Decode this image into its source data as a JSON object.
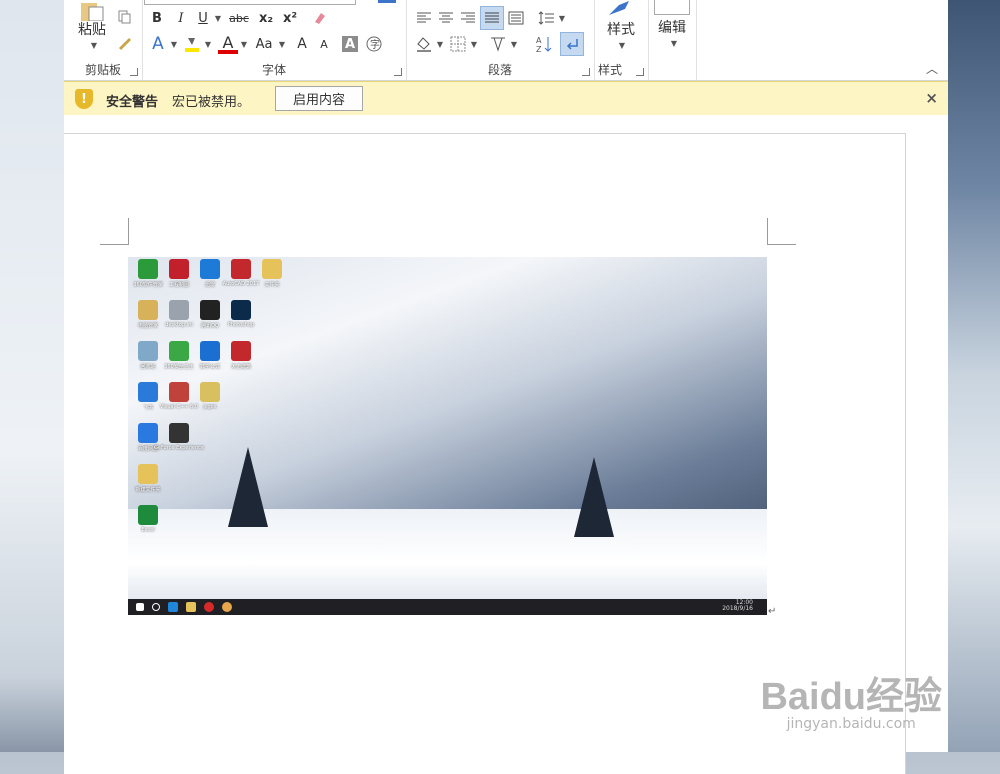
{
  "ribbon": {
    "clipboard": {
      "paste_label": "粘贴",
      "group_label": "剪贴板"
    },
    "font": {
      "group_label": "字体",
      "bold": "B",
      "italic": "I",
      "underline": "U",
      "strike": "abc",
      "subscript": "x₂",
      "superscript": "x²",
      "grow": "A",
      "shrink": "A",
      "case": "Aa",
      "font_color": "A",
      "text_effect": "A"
    },
    "paragraph": {
      "group_label": "段落"
    },
    "styles": {
      "label": "样式",
      "group_label": "样式"
    },
    "editing": {
      "label": "编辑"
    }
  },
  "security_bar": {
    "title": "安全警告",
    "message": "宏已被禁用。",
    "button": "启用内容",
    "close": "×"
  },
  "desktop_icons": [
    {
      "caption": "360软件管家",
      "color": "#2a9a3a"
    },
    {
      "caption": "工程制图",
      "color": "#c2202a"
    },
    {
      "caption": "迅雷",
      "color": "#1d7ad6"
    },
    {
      "caption": "AutoCAD 2017",
      "color": "#c3282c"
    },
    {
      "caption": "文件夹",
      "color": "#e6c35a"
    },
    {
      "caption": "电脑管家",
      "color": "#d8b25a"
    },
    {
      "caption": "desktop.ini",
      "color": "#9aa2ad"
    },
    {
      "caption": "腾讯QQ",
      "color": "#222"
    },
    {
      "caption": "Photoshop",
      "color": "#0c2a4a"
    },
    {
      "caption": "回收站",
      "color": "#7fa8c9"
    },
    {
      "caption": "360安全卫士",
      "color": "#3aa844"
    },
    {
      "caption": "数学公式",
      "color": "#1b6fd1"
    },
    {
      "caption": "天正建筑",
      "color": "#c3282c"
    },
    {
      "caption": "飞书",
      "color": "#2a7ad9"
    },
    {
      "caption": "Visual C++ 6.0",
      "color": "#c0423a"
    },
    {
      "caption": "jcgex",
      "color": "#d8c060"
    },
    {
      "caption": "百度网盘",
      "color": "#2a79e0"
    },
    {
      "caption": "GeForce Experience",
      "color": "#333"
    },
    {
      "caption": "新建文件夹",
      "color": "#e6c35a"
    },
    {
      "caption": "Excel",
      "color": "#1e8a3c"
    }
  ],
  "taskbar": {
    "time": "12:00",
    "date": "2018/9/16"
  },
  "paragraph_mark": "↵",
  "watermark": {
    "logo": "Baidu经验",
    "url": "jingyan.baidu.com"
  }
}
